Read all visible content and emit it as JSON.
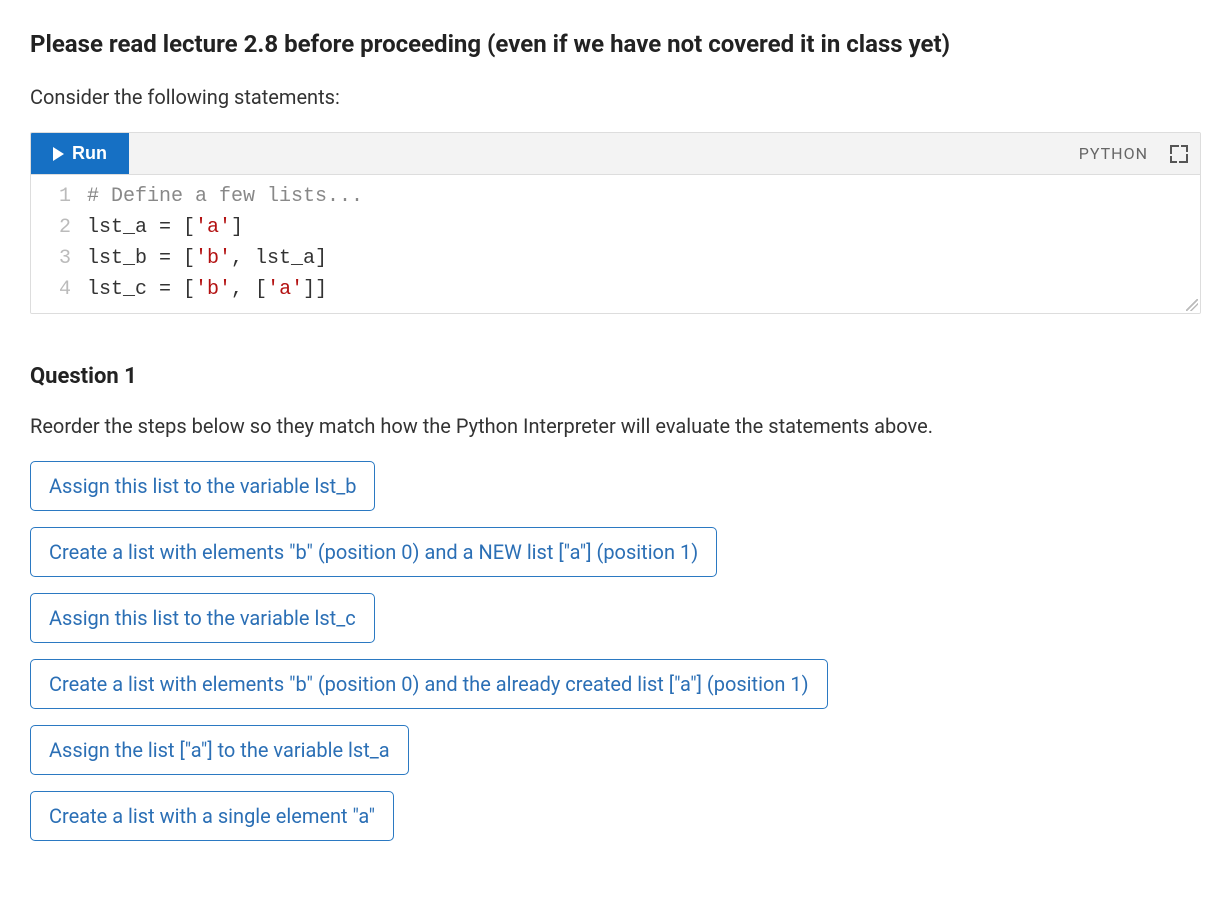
{
  "header": {
    "title": "Please read lecture 2.8 before proceeding (even if we have not covered it in class yet)"
  },
  "intro_text": "Consider the following statements:",
  "code_editor": {
    "run_label": "Run",
    "language_label": "PYTHON",
    "lines": [
      {
        "n": "1",
        "tokens": [
          {
            "t": "# Define a few lists...",
            "cls": "tok-comment"
          }
        ]
      },
      {
        "n": "2",
        "tokens": [
          {
            "t": "lst_a = [",
            "cls": ""
          },
          {
            "t": "'a'",
            "cls": "tok-str"
          },
          {
            "t": "]",
            "cls": ""
          }
        ]
      },
      {
        "n": "3",
        "tokens": [
          {
            "t": "lst_b = [",
            "cls": ""
          },
          {
            "t": "'b'",
            "cls": "tok-str"
          },
          {
            "t": ", lst_a]",
            "cls": ""
          }
        ]
      },
      {
        "n": "4",
        "tokens": [
          {
            "t": "lst_c = [",
            "cls": ""
          },
          {
            "t": "'b'",
            "cls": "tok-str"
          },
          {
            "t": ", [",
            "cls": ""
          },
          {
            "t": "'a'",
            "cls": "tok-str"
          },
          {
            "t": "]]",
            "cls": ""
          }
        ]
      }
    ]
  },
  "question": {
    "title": "Question 1",
    "prompt": "Reorder the steps below so they match how the Python Interpreter will evaluate the statements above.",
    "items": [
      "Assign this list to the variable lst_b",
      "Create a list with elements \"b\" (position 0) and a NEW list [\"a\"] (position 1)",
      "Assign this list to the variable lst_c",
      "Create a list with elements \"b\" (position 0) and the already created list [\"a\"] (position 1)",
      "Assign the list [\"a\"] to the variable lst_a",
      "Create a list with a single element \"a\""
    ]
  }
}
